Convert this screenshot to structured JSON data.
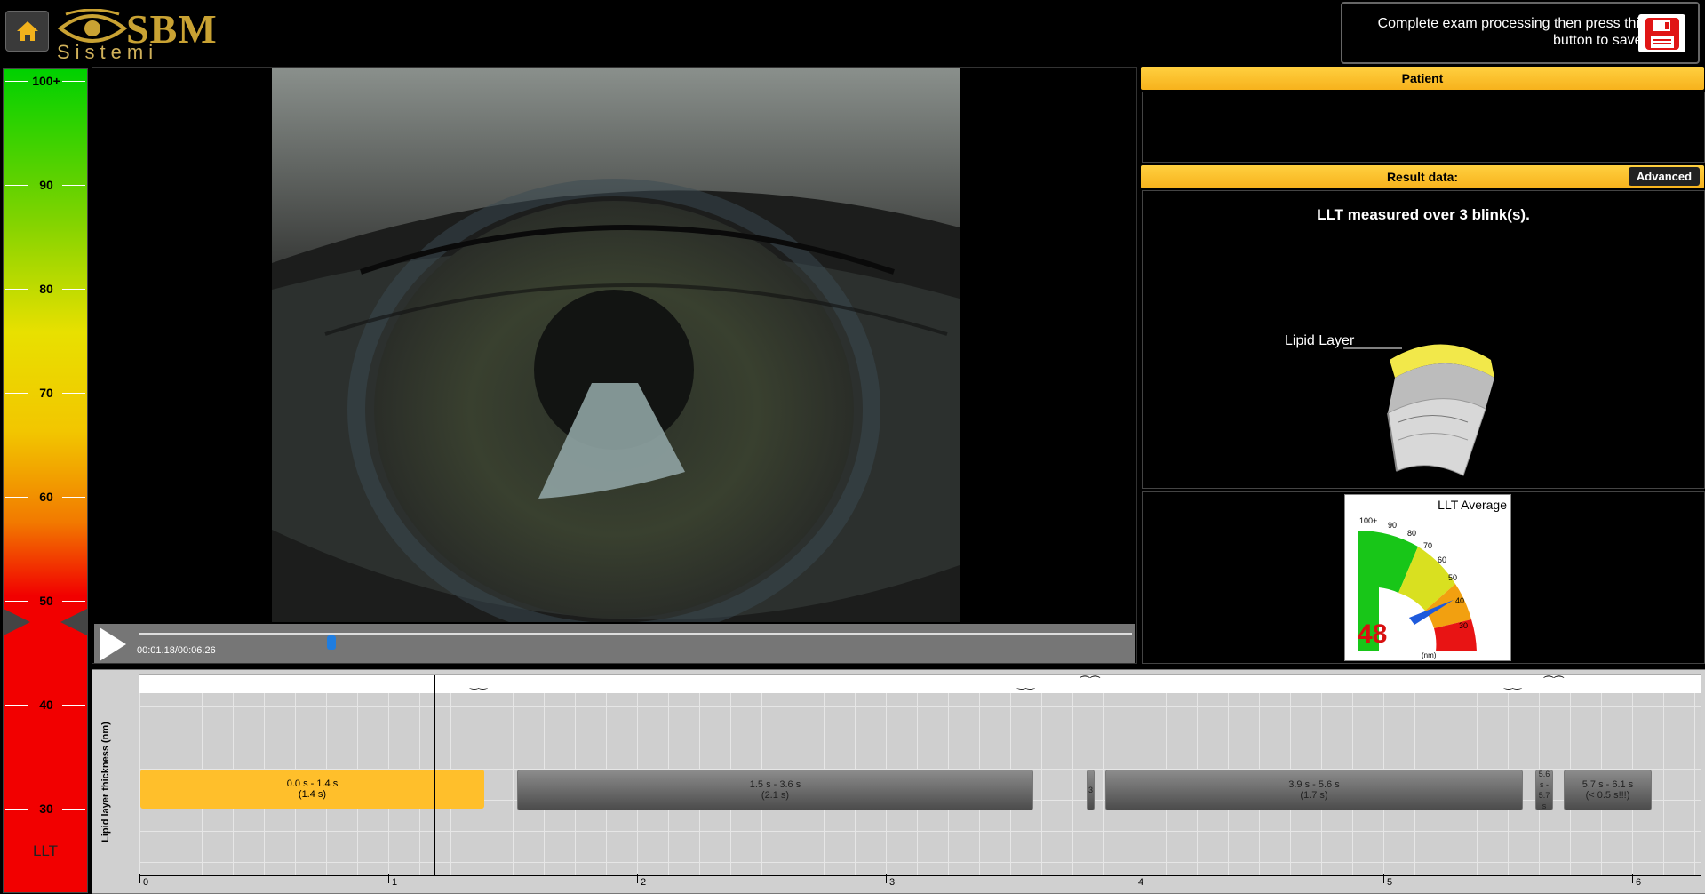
{
  "header": {
    "logo_text": "SBM",
    "logo_subtext": "Sistemi",
    "save_prompt": "Complete exam processing then press this button to save:"
  },
  "scale": {
    "ticks": [
      "100+",
      "90",
      "80",
      "70",
      "60",
      "50",
      "40",
      "30"
    ],
    "label": "LLT",
    "pointer_value": 48
  },
  "video": {
    "time": "00:01.18/00:06.26",
    "progress": 0.19
  },
  "patient": {
    "title": "Patient"
  },
  "result": {
    "title": "Result data:",
    "advanced_label": "Advanced",
    "llt_text": "LLT measured over 3 blink(s).",
    "lipid_label": "Lipid Layer"
  },
  "gauge": {
    "title": "LLT Average",
    "value": "48",
    "unit": "(nm)",
    "ticks": [
      "100+",
      "90",
      "80",
      "70",
      "60",
      "50",
      "40",
      "30"
    ]
  },
  "timeline": {
    "y_label": "Lipid layer thickness (nm)",
    "x_ticks": [
      "0",
      "1",
      "2",
      "3",
      "4",
      "5",
      "6"
    ],
    "segments": [
      {
        "line1": "0.0 s - 1.4 s",
        "line2": "(1.4 s)"
      },
      {
        "line1": "1.5 s - 3.6 s",
        "line2": "(2.1 s)"
      },
      {
        "line1": "3",
        "line2": "..."
      },
      {
        "line1": "3.9 s - 5.6 s",
        "line2": "(1.7 s)"
      },
      {
        "line1": "5.6 s - 5.7 s",
        "line2": ""
      },
      {
        "line1": "5.7 s - 6.1 s",
        "line2": "(< 0.5 s!!!)"
      }
    ]
  },
  "colors": {
    "accent": "#f7b21c",
    "save_red": "#e01515",
    "gauge_red": "#d81010"
  }
}
